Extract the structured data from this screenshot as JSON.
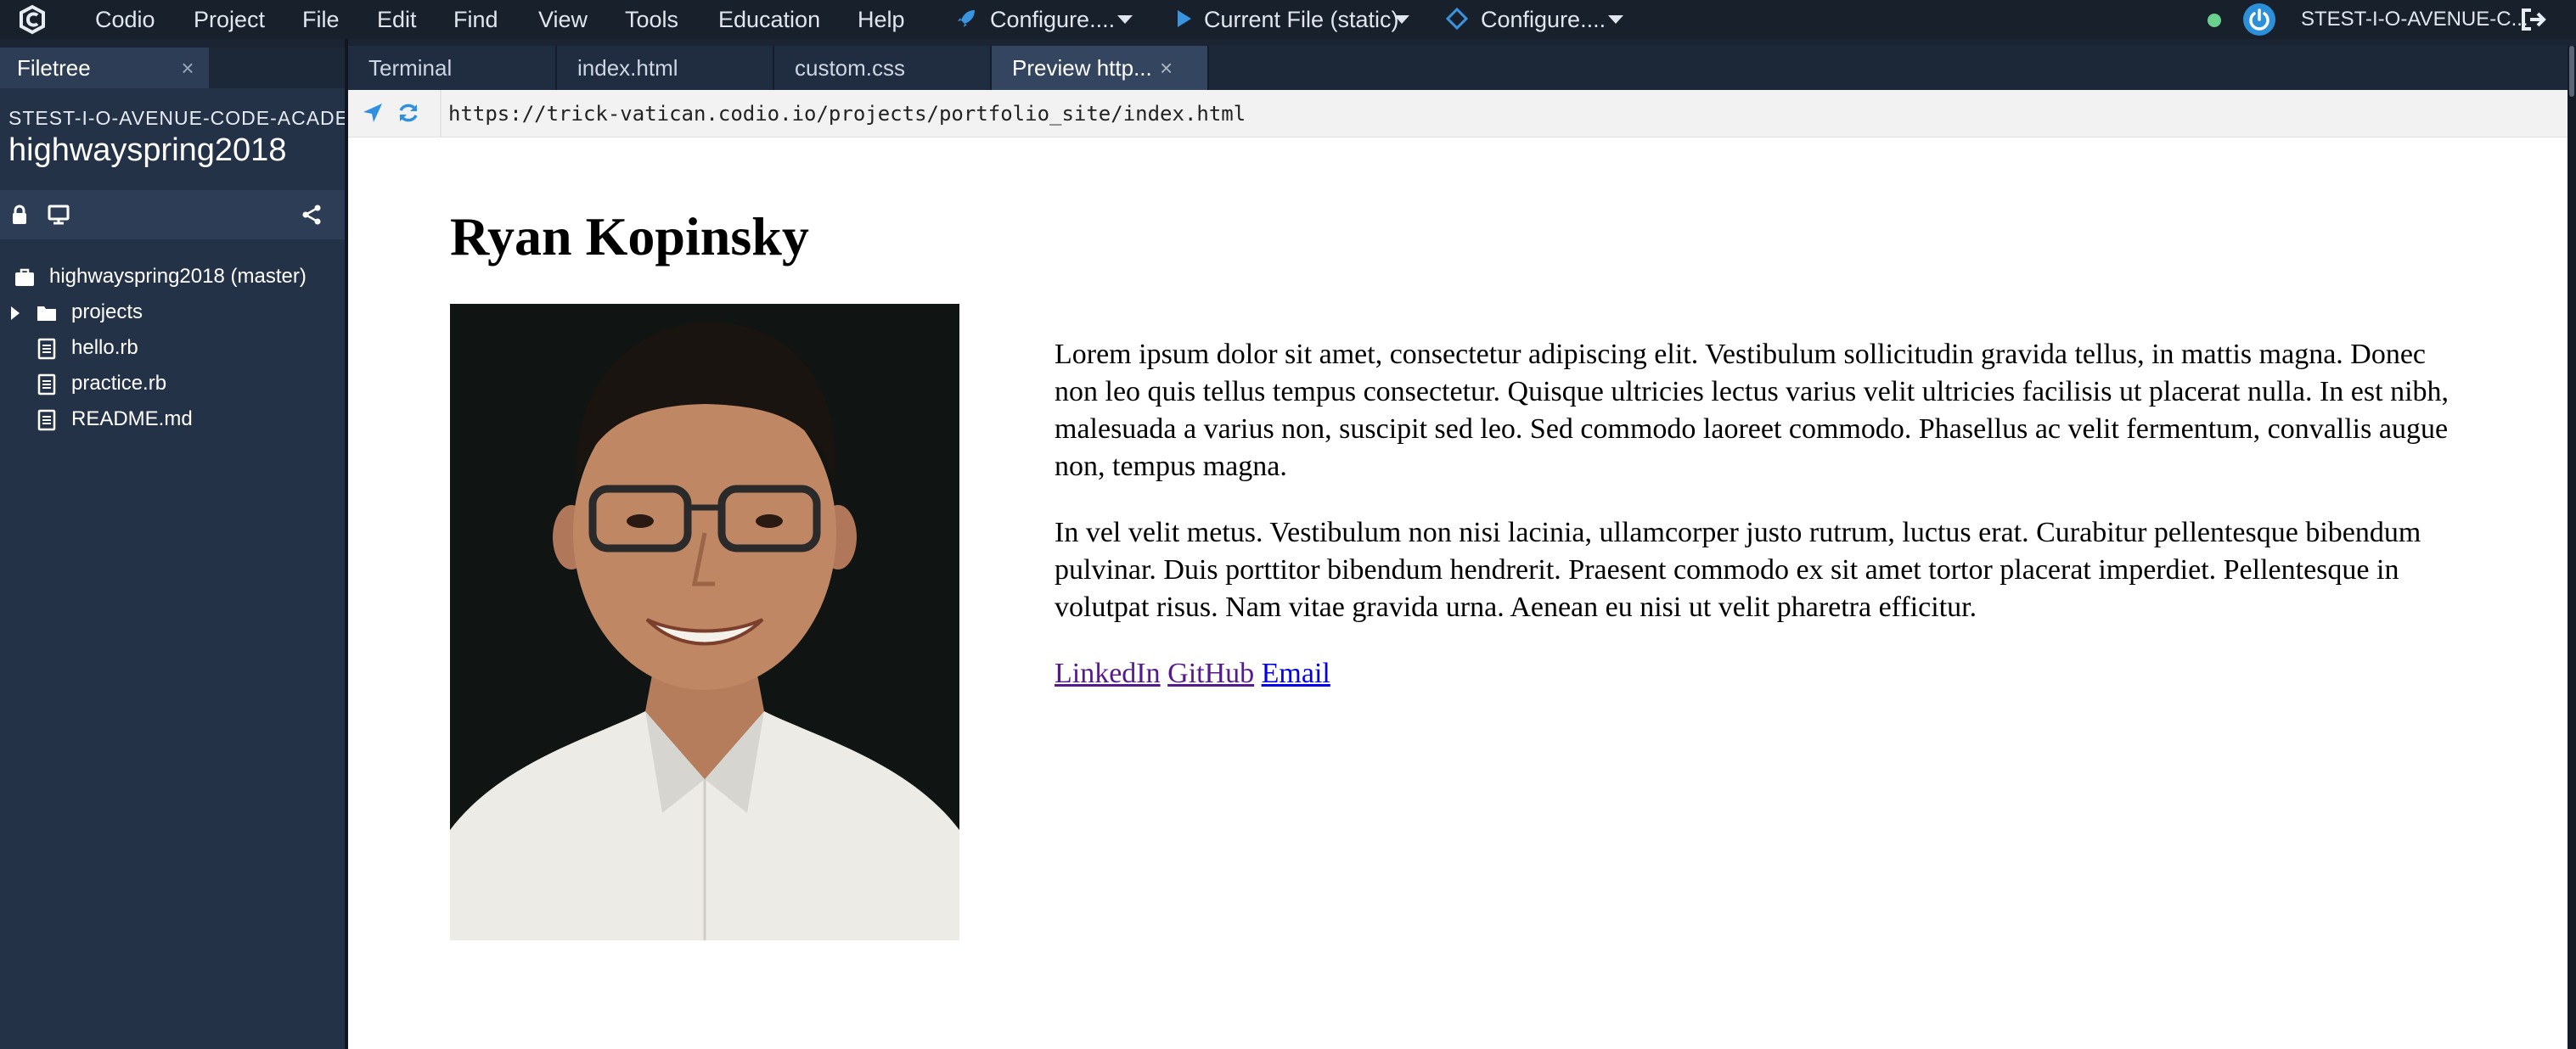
{
  "menubar": {
    "items": [
      "Codio",
      "Project",
      "File",
      "Edit",
      "Find",
      "View",
      "Tools",
      "Education",
      "Help"
    ],
    "run_configs": [
      {
        "label": "Configure....",
        "icon": "rocket-icon"
      },
      {
        "label": "Current File (static)",
        "icon": "play-icon"
      },
      {
        "label": "Configure....",
        "icon": "target-icon"
      }
    ],
    "user": "STEST-I-O-AVENUE-C...",
    "status_color": "#6bd08e",
    "accent": "#2c8fd9"
  },
  "filetree": {
    "tab_label": "Filetree",
    "close_glyph": "×",
    "owner": "STEST-I-O-AVENUE-CODE-ACADEMY",
    "project": "highwayspring2018",
    "tree": [
      {
        "label": "highwayspring2018 (master)",
        "icon": "briefcase-icon"
      },
      {
        "label": "projects",
        "icon": "folder-icon"
      },
      {
        "label": "hello.rb",
        "icon": "file-icon"
      },
      {
        "label": "practice.rb",
        "icon": "file-icon"
      },
      {
        "label": "README.md",
        "icon": "file-icon"
      }
    ]
  },
  "tabs": [
    {
      "label": "Terminal"
    },
    {
      "label": "index.html"
    },
    {
      "label": "custom.css"
    },
    {
      "label": "Preview http...",
      "active": true
    }
  ],
  "preview": {
    "url": "https://trick-vatican.codio.io/projects/portfolio_site/index.html",
    "heading": "Ryan Kopinsky",
    "paragraphs": [
      "Lorem ipsum dolor sit amet, consectetur adipiscing elit. Vestibulum sollicitudin gravida tellus, in mattis magna. Donec non leo quis tellus tempus consectetur. Quisque ultricies lectus varius velit ultricies facilisis ut placerat nulla. In est nibh, malesuada a varius non, suscipit sed leo. Sed commodo laoreet commodo. Phasellus ac velit fermentum, convallis augue non, tempus magna.",
      "In vel velit metus. Vestibulum non nisi lacinia, ullamcorper justo rutrum, luctus erat. Curabitur pellentesque bibendum pulvinar. Duis porttitor bibendum hendrerit. Praesent commodo ex sit amet tortor placerat imperdiet. Pellentesque in volutpat risus. Nam vitae gravida urna. Aenean eu nisi ut velit pharetra efficitur."
    ],
    "links": [
      "LinkedIn",
      "GitHub",
      "Email"
    ]
  }
}
